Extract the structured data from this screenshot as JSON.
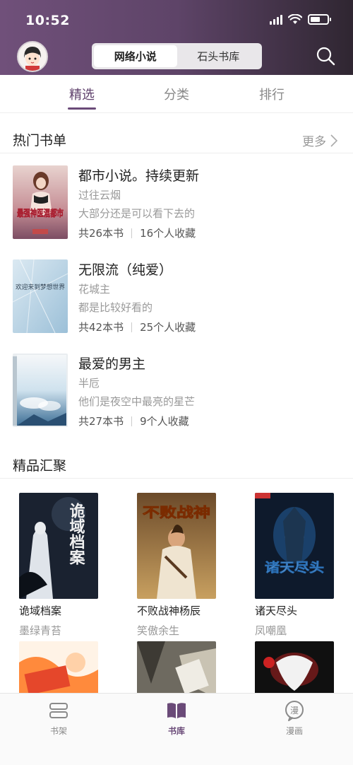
{
  "status": {
    "time": "10:52"
  },
  "header": {
    "segments": [
      "网络小说",
      "石头书库"
    ],
    "active_segment": 0
  },
  "tabs": {
    "items": [
      "精选",
      "分类",
      "排行"
    ],
    "active": 0
  },
  "hot_booklists": {
    "title": "热门书单",
    "more_label": "更多",
    "items": [
      {
        "title": "都市小说。持续更新",
        "author": "过往云烟",
        "desc": "大部分还是可以看下去的",
        "count": "共26本书",
        "saves": "16个人收藏",
        "cover_text": "最强神医混都市"
      },
      {
        "title": "无限流（纯爱）",
        "author": "花城主",
        "desc": "都是比较好看的",
        "count": "共42本书",
        "saves": "25个人收藏",
        "cover_text": "欢迎来到梦想世界"
      },
      {
        "title": "最爱的男主",
        "author": "半卮",
        "desc": "他们是夜空中最亮的星芒",
        "count": "共27本书",
        "saves": "9个人收藏",
        "cover_text": ""
      }
    ]
  },
  "featured": {
    "title": "精品汇聚",
    "books": [
      {
        "title": "诡域档案",
        "author": "墨绿青苔",
        "cover_text": "诡域档案"
      },
      {
        "title": "不败战神杨辰",
        "author": "笑傲余生",
        "cover_text": "不败战神"
      },
      {
        "title": "诸天尽头",
        "author": "凤嘲凰",
        "cover_text": "诸天尽头"
      },
      {
        "title": "",
        "author": "",
        "cover_text": ""
      },
      {
        "title": "",
        "author": "",
        "cover_text": ""
      },
      {
        "title": "",
        "author": "",
        "cover_text": ""
      }
    ]
  },
  "bottom_nav": {
    "items": [
      {
        "label": "书架",
        "icon": "bookshelf-icon"
      },
      {
        "label": "书库",
        "icon": "book-icon"
      },
      {
        "label": "漫画",
        "icon": "comic-icon"
      }
    ],
    "active": 1
  },
  "colors": {
    "accent": "#6a4a78",
    "header_start": "#70507a",
    "header_end": "#2f2631"
  }
}
